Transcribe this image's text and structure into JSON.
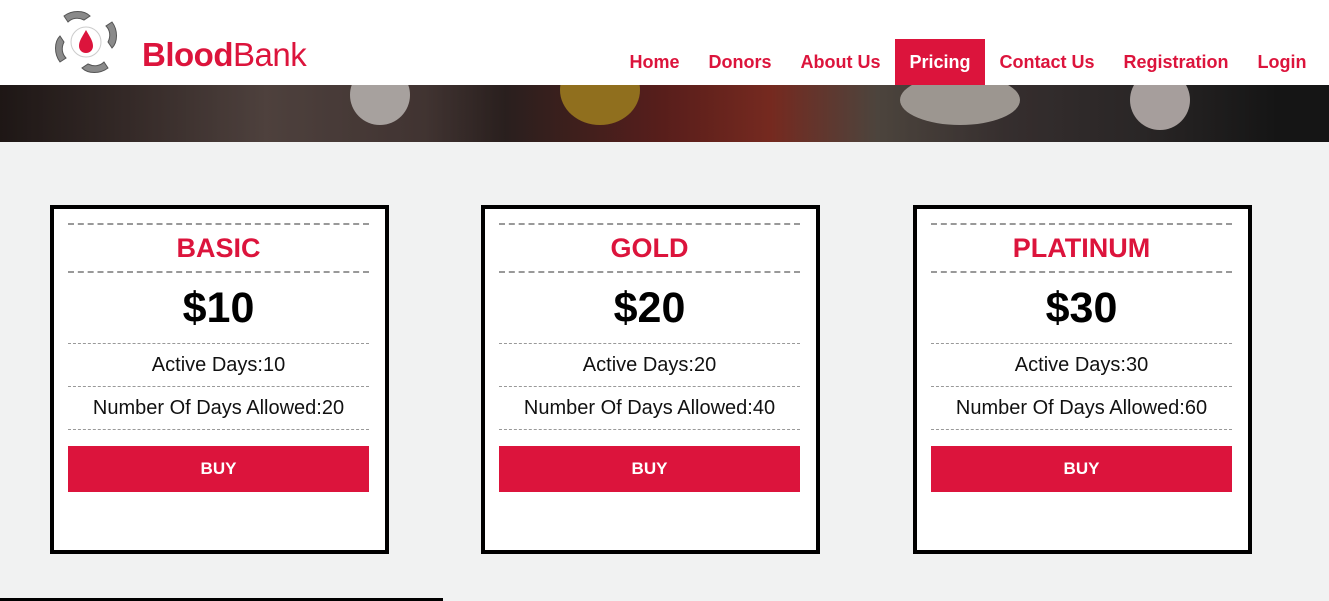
{
  "brand": {
    "name_bold": "Blood",
    "name_regular": "Bank"
  },
  "nav": {
    "items": [
      {
        "label": "Home",
        "active": false
      },
      {
        "label": "Donors",
        "active": false
      },
      {
        "label": "About Us",
        "active": false
      },
      {
        "label": "Pricing",
        "active": true
      },
      {
        "label": "Contact Us",
        "active": false
      },
      {
        "label": "Registration",
        "active": false
      },
      {
        "label": "Login",
        "active": false
      }
    ]
  },
  "colors": {
    "accent": "#dc143c",
    "background": "#f1f2f2",
    "card_border": "#000000"
  },
  "pricing": {
    "plans": [
      {
        "name": "BASIC",
        "price": "$10",
        "active_days": "Active Days:10",
        "days_allowed": "Number Of Days Allowed:20",
        "buy_label": "BUY"
      },
      {
        "name": "GOLD",
        "price": "$20",
        "active_days": "Active Days:20",
        "days_allowed": "Number Of Days Allowed:40",
        "buy_label": "BUY"
      },
      {
        "name": "PLATINUM",
        "price": "$30",
        "active_days": "Active Days:30",
        "days_allowed": "Number Of Days Allowed:60",
        "buy_label": "BUY"
      }
    ]
  }
}
